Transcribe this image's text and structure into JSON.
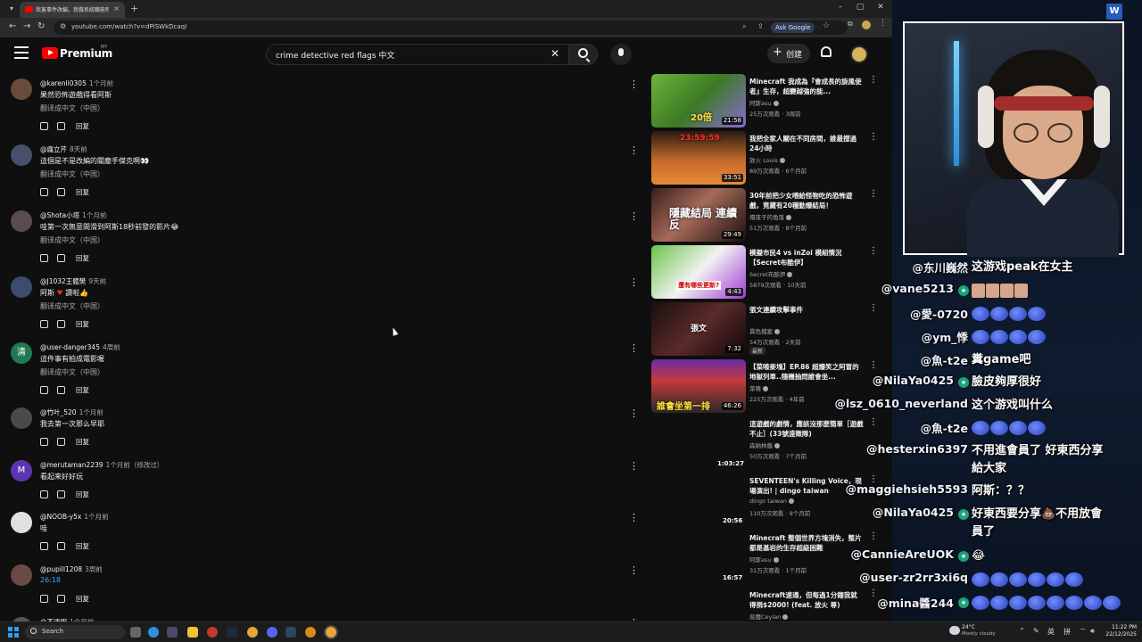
{
  "browser": {
    "tab_title": "我害事件改編。我做系統職能吧...",
    "url": "youtube.com/watch?v=dPlSWkDcaqI",
    "ask_google": "Ask Google"
  },
  "youtube": {
    "brand": "Premium",
    "country": "MY",
    "search_query": "crime detective red flags 中文",
    "create_label": "创建"
  },
  "comments": [
    {
      "author": "@karenli0305",
      "time": "1个月前",
      "text": "果然恐怖遊戲得看阿斯",
      "translate": "翻译成中文（中国）",
      "avatar": "",
      "avatar_color": "#6a4a3a"
    },
    {
      "author": "@龐立芹",
      "time": "8天前",
      "text": "這個是不是改編的關塵手傑克啊👀",
      "translate": "翻译成中文（中国）",
      "avatar": "",
      "avatar_color": "#47506a"
    },
    {
      "author": "@Shota小塔",
      "time": "1个月前",
      "text": "哇第一次無意間滑到阿斯18秒前發的影片😂",
      "translate": "翻译成中文（中国）",
      "avatar": "",
      "avatar_color": "#5a4a52"
    },
    {
      "author": "@J1032王體樊",
      "time": "9天前",
      "text": "阿斯",
      "text_heart": "♥",
      "text_after": "讚啦👍",
      "translate": "翻译成中文（中国）",
      "avatar": "",
      "avatar_color": "#3c4b6e"
    },
    {
      "author": "@user-danger345",
      "time": "4周前",
      "text": "這件事有拍成電影喔",
      "translate": "翻译成中文（中国）",
      "avatar": "清",
      "avatar_color": "#1f7a54"
    },
    {
      "author": "@竹叶_520",
      "time": "1个月前",
      "text": "我去第一次那么早耶",
      "avatar": "",
      "avatar_color": "#4a4a4a"
    },
    {
      "author": "@merutaman2239",
      "time": "1个月前（修改过）",
      "text": "看起来好好玩",
      "avatar": "M",
      "avatar_color": "#5e35b1"
    },
    {
      "author": "@NOOB-y5x",
      "time": "1个月前",
      "text": "哇",
      "avatar": "",
      "avatar_color": "#e0e0e0"
    },
    {
      "author": "@pupill1208",
      "time": "3周前",
      "text": "26:18",
      "avatar": "",
      "avatar_color": "#6b4a44"
    },
    {
      "author": "@不透明",
      "time": "1个月前",
      "text": "",
      "avatar": "",
      "avatar_color": "#555"
    }
  ],
  "reply_label": "回复",
  "recommendations": [
    {
      "title": "Minecraft 我成為『會成長的旋風使者』生存，超變越強的能...",
      "channel": "阿斯asu",
      "meta": "25万次观看 · 3周前",
      "duration": "21:58",
      "thumb_text": "20倍"
    },
    {
      "title": "我把全家人關在不同房間，誰最撐過24小時",
      "channel": "放火 Louis",
      "meta": "89万次观看 · 6个月前",
      "duration": "33:51",
      "thumb_text": "23:59:59"
    },
    {
      "title": "30年前把少女喂給怪物吃的恐怖遊戲，竟藏有20種動爆結局！",
      "channel": "壞孩子的角落",
      "meta": "51万次观看 · 8个月前",
      "duration": "29:49",
      "thumb_text": "隱藏結局 連續反"
    },
    {
      "title": "模擬市民4 vs inZoi 模組情況【Secret布酷伊】",
      "channel": "Secret布酷伊",
      "meta": "5879次观看 · 10天前",
      "duration": "4:43",
      "thumb_text": "還有哪些更新?"
    },
    {
      "title": "張文連續攻擊事件",
      "channel": "貫色檔案",
      "meta": "54万次观看 · 2天前",
      "duration": "7:32",
      "badge": "最新",
      "thumb_text": "張文"
    },
    {
      "title": "【菜喳麥塊】EP.86 超爆笑之阿冒的地獄列車..隨機抽問誰會坐...",
      "channel": "菜喳",
      "meta": "225万次观看 · 4年前",
      "duration": "46:26",
      "thumb_text": "誰會坐第一排"
    },
    {
      "title": "這遊戲的劇情，應該沒那麼簡單［遊戲不止］(33號遠徵隊)",
      "channel": "森納林蔭",
      "meta": "50万次观看 · 7个月前",
      "duration": "1:03:27"
    },
    {
      "title": "SEVENTEEN's Killing Voice，現場演出! | dingo taiwan",
      "channel": "dingo taiwan",
      "meta": "110万次观看 · 9个月前",
      "duration": "20:56"
    },
    {
      "title": "Minecraft 整個世界方塊消失，整片都是基岩的生存超級困難",
      "channel": "阿斯asu",
      "meta": "31万次观看 · 1个月前",
      "duration": "16:57"
    },
    {
      "title": "Minecraft速通，但每過1分鐘我就得捐$2000! (feat. 放火 尊)",
      "channel": "惡魔Ceylan",
      "meta": "",
      "duration": ""
    }
  ],
  "chat": [
    {
      "user": "@东川巍然",
      "badge": false,
      "msg": "这游戏peak在女主"
    },
    {
      "user": "@vane5213",
      "badge": true,
      "msg": "",
      "faces": 4
    },
    {
      "user": "@愛-0720",
      "badge": false,
      "msg": "",
      "emotes": 4
    },
    {
      "user": "@ym_悸",
      "badge": false,
      "msg": "",
      "emotes": 4
    },
    {
      "user": "@魚-t2e",
      "badge": false,
      "msg": "糞game吧"
    },
    {
      "user": "@NilaYa0425",
      "badge": true,
      "msg": "臉皮夠厚很好"
    },
    {
      "user": "@lsz_0610_neverland",
      "badge": false,
      "msg": "这个游戏叫什么"
    },
    {
      "user": "@魚-t2e",
      "badge": false,
      "msg": "",
      "emotes": 4
    },
    {
      "user": "@hesterxin6397",
      "badge": false,
      "msg": "不用進會員了 好東西分享",
      "msg2": "給大家"
    },
    {
      "user": "@maggiehsieh5593",
      "badge": false,
      "msg": "阿斯：？？"
    },
    {
      "user": "@NilaYa0425",
      "badge": true,
      "msg": "好東西要分享💩不用放會",
      "msg2": "員了"
    },
    {
      "user": "@CannieAreUOK",
      "badge": true,
      "msg": "😂"
    },
    {
      "user": "@user-zr2rr3xi6q",
      "badge": false,
      "msg": "",
      "emotes": 6
    },
    {
      "user": "@mina醬244",
      "badge": true,
      "msg": "",
      "emotes": 8
    }
  ],
  "taskbar": {
    "search_label": "Search",
    "weather_temp": "24°C",
    "weather_desc": "Mostly cloudy",
    "ime_lang": "英",
    "ime_mode": "拼",
    "time": "11:22 PM",
    "date": "22/12/2025"
  },
  "colors": {
    "accent": "#ff0000",
    "link": "#3ea6ff",
    "chat_badge": "#1aa37a"
  }
}
